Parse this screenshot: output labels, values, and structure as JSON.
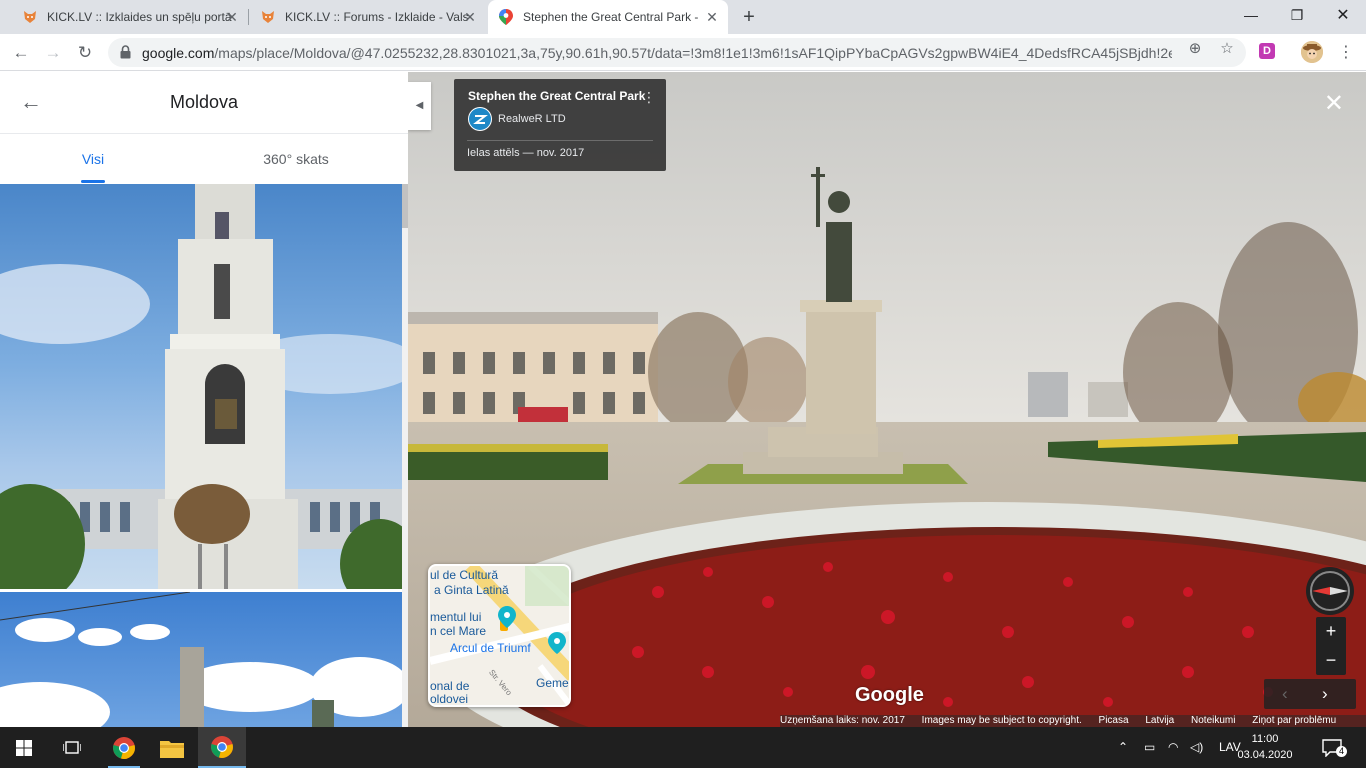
{
  "browser": {
    "tabs": [
      {
        "title": "KICK.LV :: Izklaides un spēļu portā",
        "favicon": "fox-icon",
        "active": false
      },
      {
        "title": "KICK.LV :: Forums - Izklaide - Vals",
        "favicon": "fox-icon",
        "active": false
      },
      {
        "title": "Stephen the Great Central Park -",
        "favicon": "maps-pin-icon",
        "active": true
      }
    ],
    "new_tab_label": "+",
    "url_host": "google.com",
    "url_path": "/maps/place/Moldova/@47.0255232,28.8301021,3a,75y,90.61h,90.57t/data=!3m8!1e1!3m6!1sAF1QipPYbaCpAGVs2gpwBW4iE4_4DedsfRCA45jSBjdh!2e10...",
    "extension_letter": "D"
  },
  "left_panel": {
    "title": "Moldova",
    "tabs": [
      {
        "label": "Visi",
        "selected": true
      },
      {
        "label": "360° skats",
        "selected": false
      }
    ]
  },
  "street_view": {
    "place_name": "Stephen the Great Central Park",
    "author": "RealweR LTD",
    "image_date": "Ielas attēls — nov. 2017",
    "watermark": "Google",
    "footer": [
      "Uzņemšana laiks: nov. 2017",
      "Images may be subject to copyright.",
      "Picasa",
      "Latvija",
      "Noteikumi",
      "Ziņot par problēmu"
    ],
    "minimap_labels": [
      "ul de Cultură",
      "a Ginta Latină",
      "mentul lui",
      "n cel Mare",
      "Arcul de Triumf",
      "onal de",
      "oldovei",
      "Geme",
      "Str. Vero"
    ],
    "zoom_in": "+",
    "zoom_out": "−"
  },
  "taskbar": {
    "language": "LAV",
    "time": "11:00",
    "date": "03.04.2020",
    "notification_count": "4"
  },
  "colors": {
    "accent_blue": "#1a73e8",
    "tab_strip": "#dee1e6",
    "taskbar": "#1f1f1f"
  }
}
